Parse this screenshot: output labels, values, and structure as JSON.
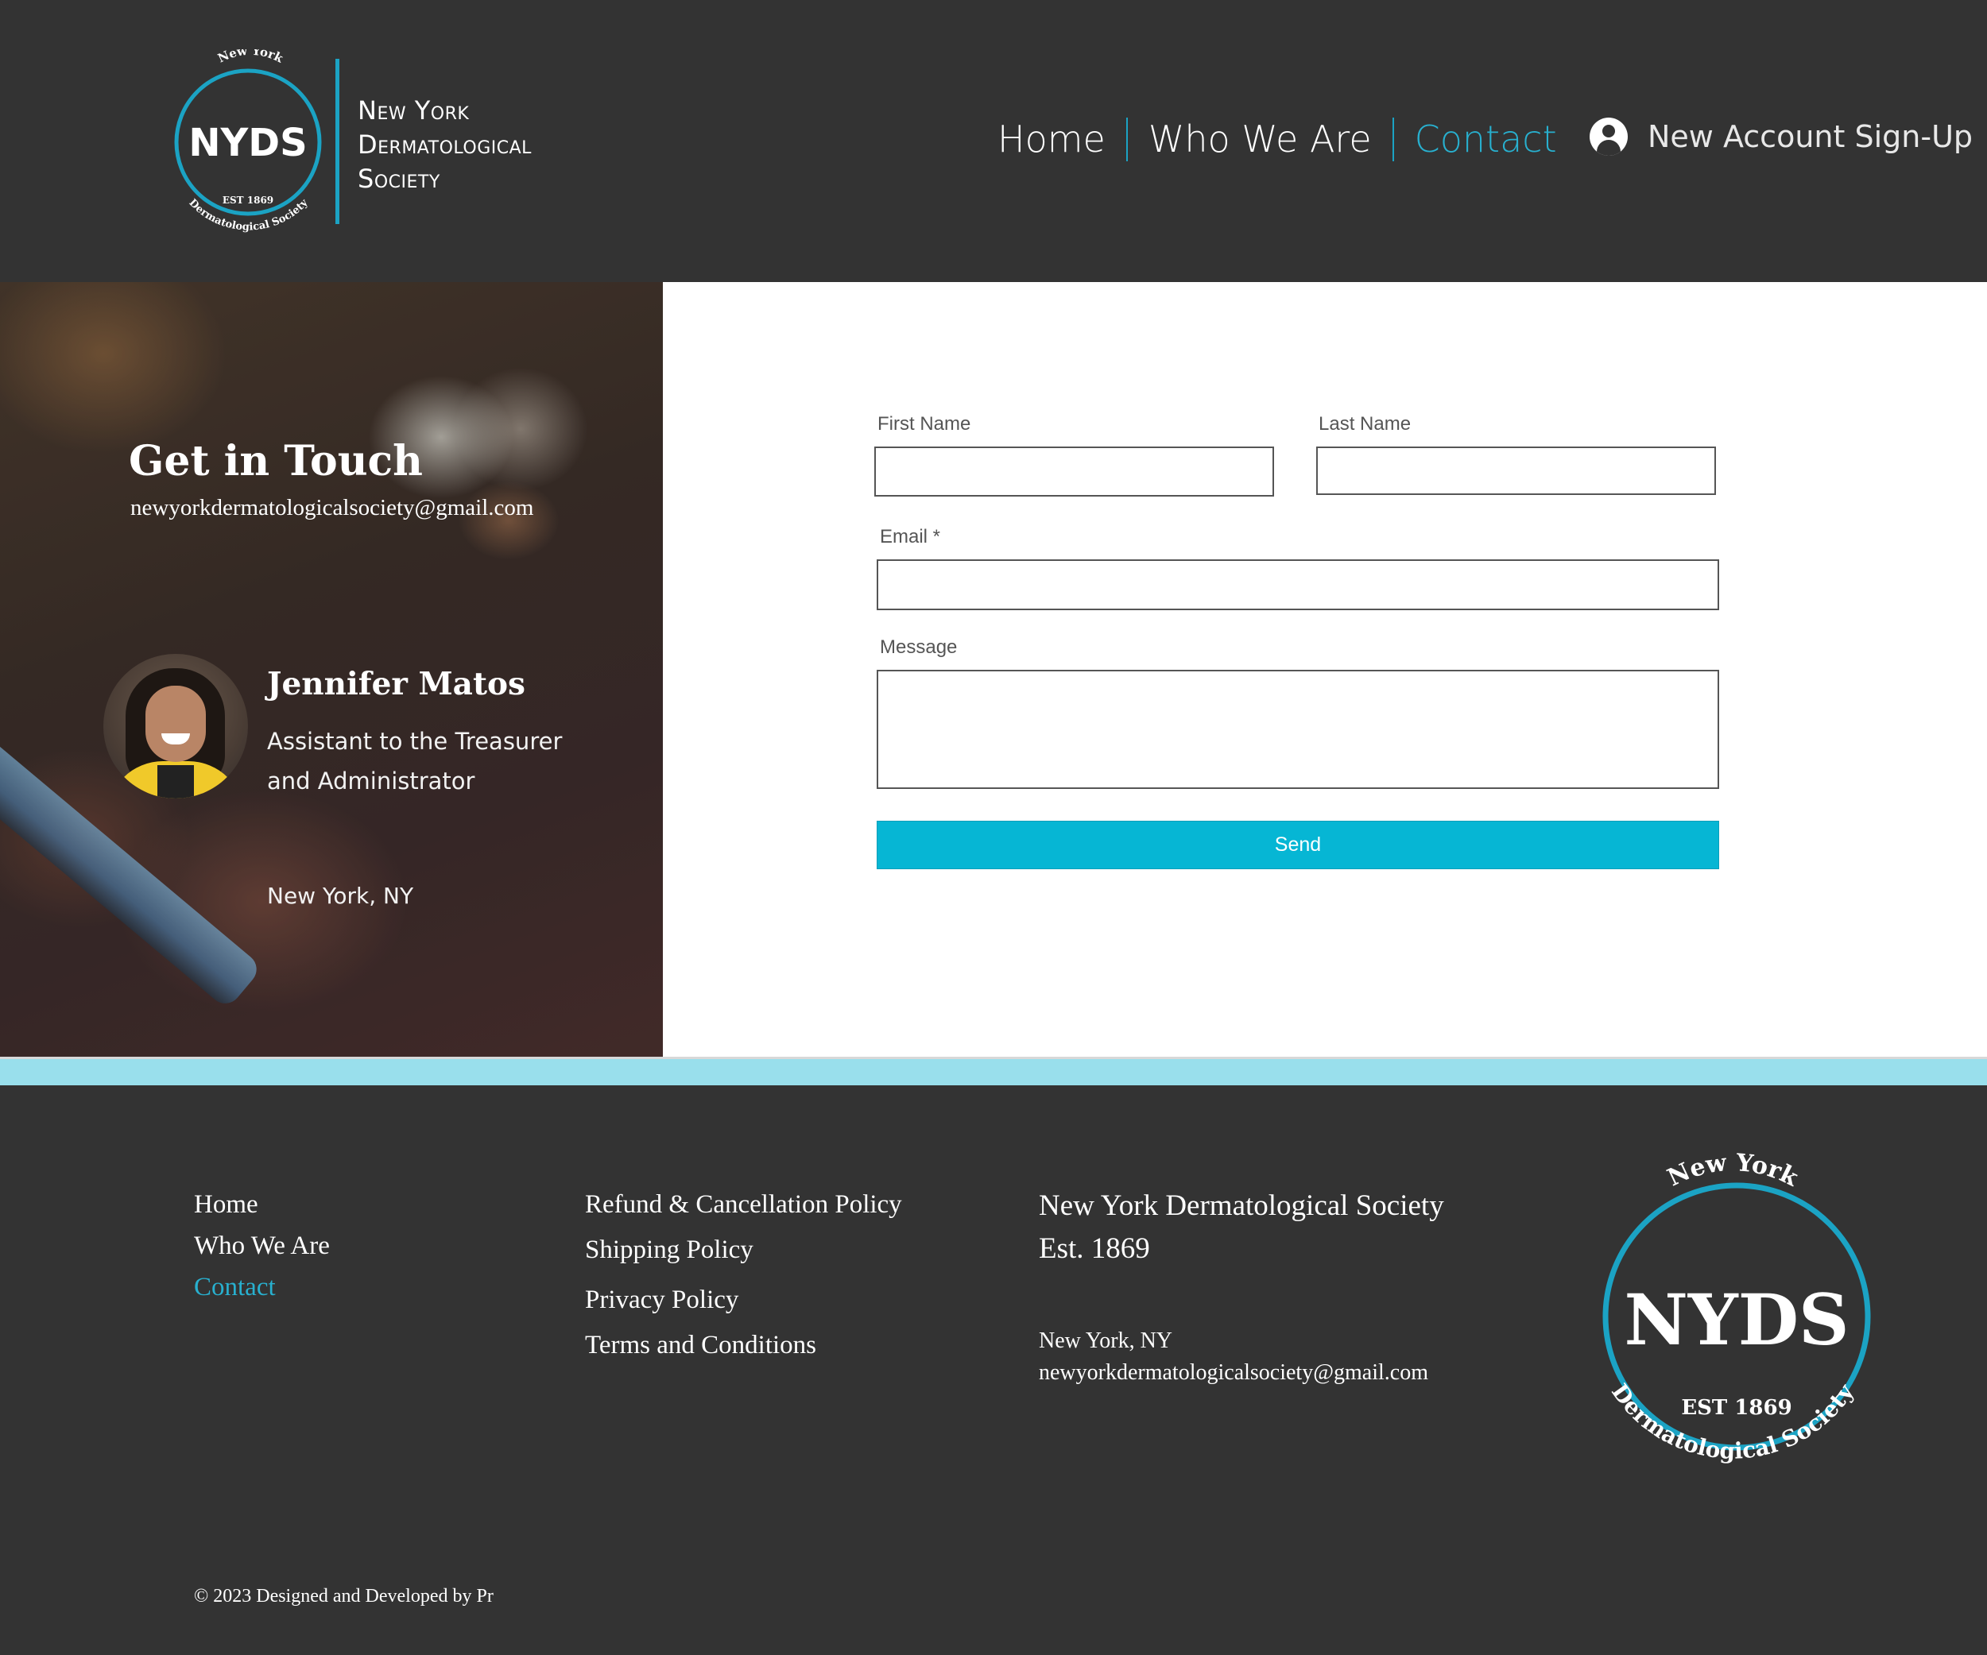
{
  "header": {
    "logo": {
      "seal_abbr": "NYDS",
      "seal_top_text": "New York",
      "seal_bottom_text": "Dermatological Society",
      "seal_est": "EST 1869",
      "wordmark_lines": [
        "New York",
        "Dermatological",
        "Society"
      ]
    },
    "nav": [
      {
        "label": "Home",
        "active": false
      },
      {
        "label": "Who We Are",
        "active": false
      },
      {
        "label": "Contact",
        "active": true
      }
    ],
    "signup_label": "New Account Sign-Up"
  },
  "contact_panel": {
    "title": "Get in Touch",
    "email": "newyorkdermatologicalsociety@gmail.com",
    "person": {
      "name": "Jennifer Matos",
      "role": "Assistant to the Treasurer and Administrator",
      "location": "New York, NY"
    }
  },
  "form": {
    "first_name_label": "First Name",
    "first_name_value": "",
    "last_name_label": "Last Name",
    "last_name_value": "",
    "email_label": "Email *",
    "email_value": "",
    "message_label": "Message",
    "message_value": "",
    "send_label": "Send"
  },
  "footer": {
    "nav": [
      {
        "label": "Home",
        "active": false
      },
      {
        "label": "Who We Are",
        "active": false
      },
      {
        "label": "Contact",
        "active": true
      }
    ],
    "policies": [
      "Refund & Cancellation Policy",
      "Shipping Policy",
      "Privacy Policy",
      "Terms and Conditions"
    ],
    "org_name": "New York Dermatological Society",
    "org_est": "Est. 1869",
    "location": "New York, NY",
    "email": "newyorkdermatologicalsociety@gmail.com",
    "copyright": "© 2023 Designed and Developed by Pr"
  },
  "colors": {
    "background": "#333333",
    "accent": "#1ba3c4",
    "active_link": "#28b0cf",
    "send_button": "#06b6d4",
    "strip": "#99dfec"
  }
}
